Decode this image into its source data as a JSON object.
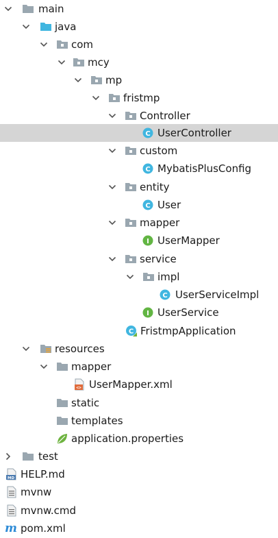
{
  "tree": {
    "items": [
      {
        "label": "main",
        "icon": "folder-icon",
        "expanded": true
      },
      {
        "label": "java",
        "icon": "source-folder-icon",
        "expanded": true
      },
      {
        "label": "com",
        "icon": "package-icon",
        "expanded": true
      },
      {
        "label": "mcy",
        "icon": "package-icon",
        "expanded": true
      },
      {
        "label": "mp",
        "icon": "package-icon",
        "expanded": true
      },
      {
        "label": "fristmp",
        "icon": "package-icon",
        "expanded": true
      },
      {
        "label": "Controller",
        "icon": "package-icon",
        "expanded": true
      },
      {
        "label": "UserController",
        "icon": "class-icon",
        "selected": true
      },
      {
        "label": "custom",
        "icon": "package-icon",
        "expanded": true
      },
      {
        "label": "MybatisPlusConfig",
        "icon": "class-icon"
      },
      {
        "label": "entity",
        "icon": "package-icon",
        "expanded": true
      },
      {
        "label": "User",
        "icon": "class-icon"
      },
      {
        "label": "mapper",
        "icon": "package-icon",
        "expanded": true
      },
      {
        "label": "UserMapper",
        "icon": "interface-icon"
      },
      {
        "label": "service",
        "icon": "package-icon",
        "expanded": true
      },
      {
        "label": "impl",
        "icon": "package-icon",
        "expanded": true
      },
      {
        "label": "UserServiceImpl",
        "icon": "class-icon"
      },
      {
        "label": "UserService",
        "icon": "interface-icon"
      },
      {
        "label": "FristmpApplication",
        "icon": "spring-boot-class-icon"
      },
      {
        "label": "resources",
        "icon": "resources-folder-icon",
        "expanded": true
      },
      {
        "label": "mapper",
        "icon": "folder-icon",
        "expanded": true
      },
      {
        "label": "UserMapper.xml",
        "icon": "xml-file-icon"
      },
      {
        "label": "static",
        "icon": "folder-icon"
      },
      {
        "label": "templates",
        "icon": "folder-icon"
      },
      {
        "label": "application.properties",
        "icon": "spring-properties-icon"
      },
      {
        "label": "test",
        "icon": "folder-icon",
        "expanded": false
      },
      {
        "label": "HELP.md",
        "icon": "markdown-file-icon"
      },
      {
        "label": "mvnw",
        "icon": "text-file-icon"
      },
      {
        "label": "mvnw.cmd",
        "icon": "text-file-icon"
      },
      {
        "label": "pom.xml",
        "icon": "maven-file-icon"
      }
    ]
  },
  "colors": {
    "selection": "#d5d5d5",
    "folder": "#9aa7b0",
    "source_folder": "#40b6e0",
    "class_icon": "#40b6e0",
    "interface_icon": "#62b543",
    "xml_icon": "#e06c3c",
    "maven_icon": "#2e8bd6",
    "spring": "#6db33f"
  }
}
